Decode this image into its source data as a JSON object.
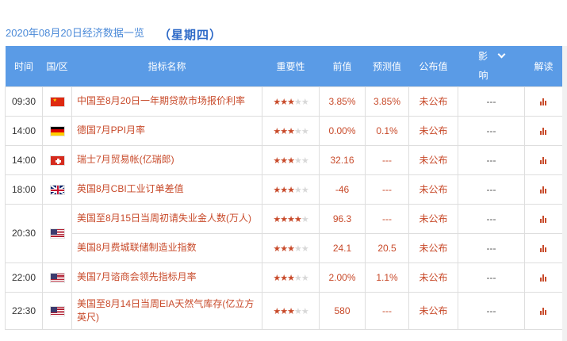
{
  "header": {
    "date_title": "2020年08月20日经济数据一览",
    "weekday": "（星期四）"
  },
  "table": {
    "columns": {
      "time": "时间",
      "region": "国/区",
      "indicator": "指标名称",
      "importance": "重要性",
      "previous": "前值",
      "forecast": "预测值",
      "actual": "公布值",
      "impact_line1": "影",
      "impact_line2": "响",
      "analysis": "解读"
    },
    "rows": [
      {
        "time": "09:30",
        "flag": "china-flag-icon",
        "name": "中国至8月20日一年期贷款市场报价利率",
        "stars": 3,
        "prev": "3.85%",
        "forecast": "3.85%",
        "actual": "未公布",
        "impact": "---"
      },
      {
        "time": "14:00",
        "flag": "germany-flag-icon",
        "name": "德国7月PPI月率",
        "stars": 3,
        "prev": "0.00%",
        "forecast": "0.1%",
        "actual": "未公布",
        "impact": "---"
      },
      {
        "time": "14:00",
        "flag": "switzerland-flag-icon",
        "name": "瑞士7月贸易帐(亿瑞郎)",
        "stars": 3,
        "prev": "32.16",
        "forecast": "---",
        "actual": "未公布",
        "impact": "---"
      },
      {
        "time": "18:00",
        "flag": "uk-flag-icon",
        "name": "英国8月CBI工业订单差值",
        "stars": 3,
        "prev": "-46",
        "forecast": "---",
        "actual": "未公布",
        "impact": "---"
      },
      {
        "time": "20:30",
        "flag": "usa-flag-icon",
        "name": "美国至8月15日当周初请失业金人数(万人)",
        "stars": 4,
        "prev": "96.3",
        "forecast": "---",
        "actual": "未公布",
        "impact": "---"
      },
      {
        "time": "",
        "flag": "",
        "name": "美国8月费城联储制造业指数",
        "stars": 3,
        "prev": "24.1",
        "forecast": "20.5",
        "actual": "未公布",
        "impact": "---"
      },
      {
        "time": "22:00",
        "flag": "usa-flag-icon",
        "name": "美国7月谘商会领先指标月率",
        "stars": 3,
        "prev": "2.00%",
        "forecast": "1.1%",
        "actual": "未公布",
        "impact": "---"
      },
      {
        "time": "22:30",
        "flag": "usa-flag-icon",
        "name": "美国至8月14日当周EIA天然气库存(亿立方英尺)",
        "stars": 3,
        "prev": "580",
        "forecast": "---",
        "actual": "未公布",
        "impact": "---"
      }
    ]
  },
  "colors": {
    "header_bg": "#5a9be6",
    "accent_red": "#c84a2a",
    "title_blue": "#4b8ad8"
  }
}
